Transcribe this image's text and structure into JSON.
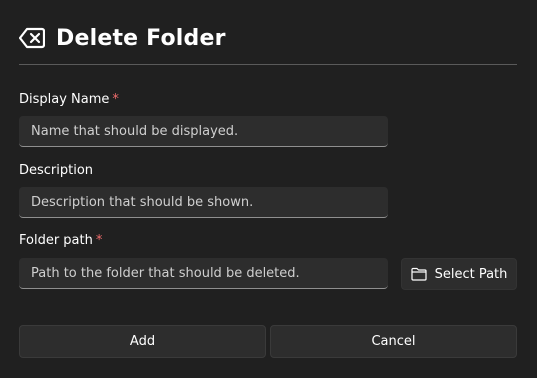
{
  "header": {
    "icon": "backspace-icon",
    "title": "Delete Folder"
  },
  "fields": {
    "display_name": {
      "label": "Display Name",
      "required_marker": "*",
      "placeholder": "Name that should be displayed."
    },
    "description": {
      "label": "Description",
      "placeholder": "Description that should be shown."
    },
    "folder_path": {
      "label": "Folder path",
      "required_marker": "*",
      "placeholder": "Path to the folder that should be deleted.",
      "select_button_label": "Select Path",
      "select_button_icon": "folder-icon"
    }
  },
  "actions": {
    "add_label": "Add",
    "cancel_label": "Cancel"
  },
  "colors": {
    "background": "#202020",
    "field_background": "#2d2d2d",
    "required": "#f26d6d"
  }
}
